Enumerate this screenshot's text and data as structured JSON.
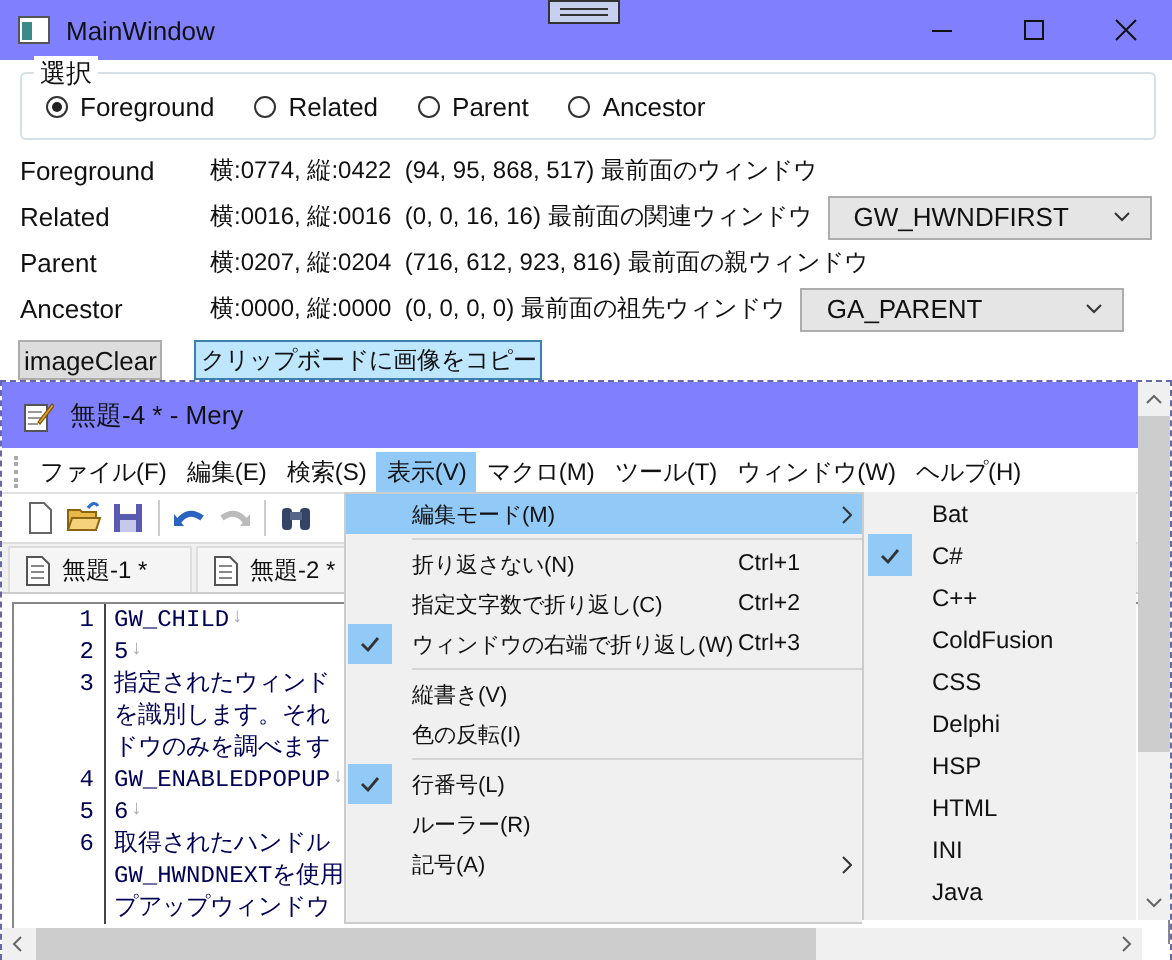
{
  "window": {
    "title": "MainWindow"
  },
  "selection": {
    "legend": "選択",
    "options": [
      {
        "label": "Foreground",
        "selected": true
      },
      {
        "label": "Related",
        "selected": false
      },
      {
        "label": "Parent",
        "selected": false
      },
      {
        "label": "Ancestor",
        "selected": false
      }
    ]
  },
  "info_rows": [
    {
      "label": "Foreground",
      "value": "横:0774, 縦:0422  (94, 95, 868, 517) 最前面のウィンドウ"
    },
    {
      "label": "Related",
      "value": "横:0016, 縦:0016  (0, 0, 16, 16) 最前面の関連ウィンドウ",
      "dropdown": "GW_HWNDFIRST"
    },
    {
      "label": "Parent",
      "value": "横:0207, 縦:0204  (716, 612, 923, 816) 最前面の親ウィンドウ"
    },
    {
      "label": "Ancestor",
      "value": "横:0000, 縦:0000  (0, 0, 0, 0) 最前面の祖先ウィンドウ",
      "dropdown": "GA_PARENT"
    }
  ],
  "buttons": [
    {
      "label": "imageClear",
      "kind": "plain"
    },
    {
      "label": "クリップボードに画像をコピー",
      "kind": "accent"
    }
  ],
  "capture": {
    "title": "無題-4 * - Mery",
    "menu": [
      {
        "label": "ファイル(F)",
        "selected": false
      },
      {
        "label": "編集(E)",
        "selected": false
      },
      {
        "label": "検索(S)",
        "selected": false
      },
      {
        "label": "表示(V)",
        "selected": true
      },
      {
        "label": "マクロ(M)",
        "selected": false
      },
      {
        "label": "ツール(T)",
        "selected": false
      },
      {
        "label": "ウィンドウ(W)",
        "selected": false
      },
      {
        "label": "ヘルプ(H)",
        "selected": false
      }
    ],
    "tabs": [
      {
        "label": "無題-1 *"
      },
      {
        "label": "無題-2 *"
      }
    ],
    "lines": [
      {
        "number": "1",
        "text": "GW_CHILD",
        "eol": "↓"
      },
      {
        "number": "2",
        "text": "5",
        "eol": "↓"
      },
      {
        "number": "3",
        "text": "指定されたウィンド"
      },
      {
        "text": "を識別します。それ"
      },
      {
        "text": "ドウのみを調べます"
      },
      {
        "number": "4",
        "text": "GW_ENABLEDPOPUP",
        "eol": "↓"
      },
      {
        "number": "5",
        "text": "6",
        "eol": "↓"
      },
      {
        "number": "6",
        "text": "取得されたハンドル"
      },
      {
        "text": "GW_HWNDNEXTを使用"
      },
      {
        "text": "プアップウィンドウ"
      }
    ],
    "dropdown": [
      {
        "kind": "item",
        "label": "編集モード(M)",
        "submenu": true,
        "selected": true,
        "checked": false
      },
      {
        "kind": "separator"
      },
      {
        "kind": "item",
        "label": "折り返さない(N)",
        "shortcut": "Ctrl+1",
        "submenu": false,
        "selected": false,
        "checked": false
      },
      {
        "kind": "item",
        "label": "指定文字数で折り返し(C)",
        "shortcut": "Ctrl+2",
        "submenu": false,
        "selected": false,
        "checked": false
      },
      {
        "kind": "item",
        "label": "ウィンドウの右端で折り返し(W)",
        "shortcut": "Ctrl+3",
        "submenu": false,
        "selected": false,
        "checked": true
      },
      {
        "kind": "separator"
      },
      {
        "kind": "item",
        "label": "縦書き(V)",
        "submenu": false,
        "selected": false,
        "checked": false
      },
      {
        "kind": "item",
        "label": "色の反転(I)",
        "submenu": false,
        "selected": false,
        "checked": false
      },
      {
        "kind": "separator"
      },
      {
        "kind": "item",
        "label": "行番号(L)",
        "submenu": false,
        "selected": false,
        "checked": true
      },
      {
        "kind": "item",
        "label": "ルーラー(R)",
        "submenu": false,
        "selected": false,
        "checked": false
      },
      {
        "kind": "item",
        "label": "記号(A)",
        "submenu": true,
        "selected": false,
        "checked": false
      }
    ],
    "submenu": [
      {
        "label": "Bat",
        "checked": false
      },
      {
        "label": "C#",
        "checked": true
      },
      {
        "label": "C++",
        "checked": false
      },
      {
        "label": "ColdFusion",
        "checked": false
      },
      {
        "label": "CSS",
        "checked": false
      },
      {
        "label": "Delphi",
        "checked": false
      },
      {
        "label": "HSP",
        "checked": false
      },
      {
        "label": "HTML",
        "checked": false
      },
      {
        "label": "INI",
        "checked": false
      },
      {
        "label": "Java",
        "checked": false
      }
    ]
  }
}
